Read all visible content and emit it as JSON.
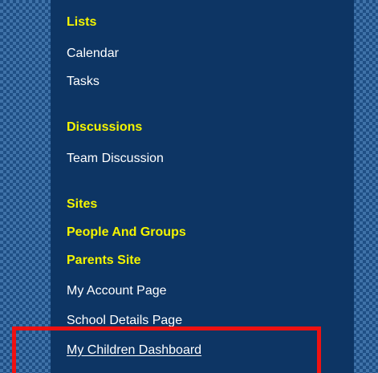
{
  "nav": {
    "sections": [
      {
        "heading": "Lists",
        "items": [
          "Calendar",
          "Tasks"
        ]
      },
      {
        "heading": "Discussions",
        "items": [
          "Team Discussion"
        ]
      },
      {
        "heading": "Sites",
        "items": []
      },
      {
        "heading": "People And Groups",
        "items": []
      },
      {
        "heading": "Parents Site",
        "items": [
          "My Account Page",
          "School Details Page",
          "My Children Dashboard"
        ]
      }
    ]
  },
  "colors": {
    "panel_background": "#0d3564",
    "heading_text": "#f5f500",
    "link_text": "#ffffff",
    "highlight_border": "#ee1111"
  }
}
